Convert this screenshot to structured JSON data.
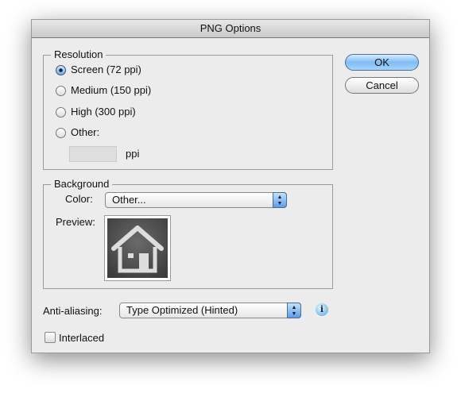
{
  "window": {
    "title": "PNG Options"
  },
  "resolution": {
    "label": "Resolution",
    "options": [
      {
        "label": "Screen (72 ppi)",
        "selected": true
      },
      {
        "label": "Medium (150 ppi)",
        "selected": false
      },
      {
        "label": "High (300 ppi)",
        "selected": false
      },
      {
        "label": "Other:",
        "selected": false
      }
    ],
    "other_value": "",
    "unit": "ppi"
  },
  "background": {
    "label": "Background",
    "color_label": "Color:",
    "color_value": "Other...",
    "preview_label": "Preview:",
    "preview_icon": "home-icon"
  },
  "anti_aliasing": {
    "label": "Anti-aliasing:",
    "value": "Type Optimized (Hinted)",
    "info_icon": "info-icon"
  },
  "interlaced": {
    "label": "Interlaced",
    "checked": false
  },
  "buttons": {
    "ok": "OK",
    "cancel": "Cancel"
  },
  "colors": {
    "accent": "#7fbcf4",
    "preview_bg": "#4a4a4a"
  }
}
